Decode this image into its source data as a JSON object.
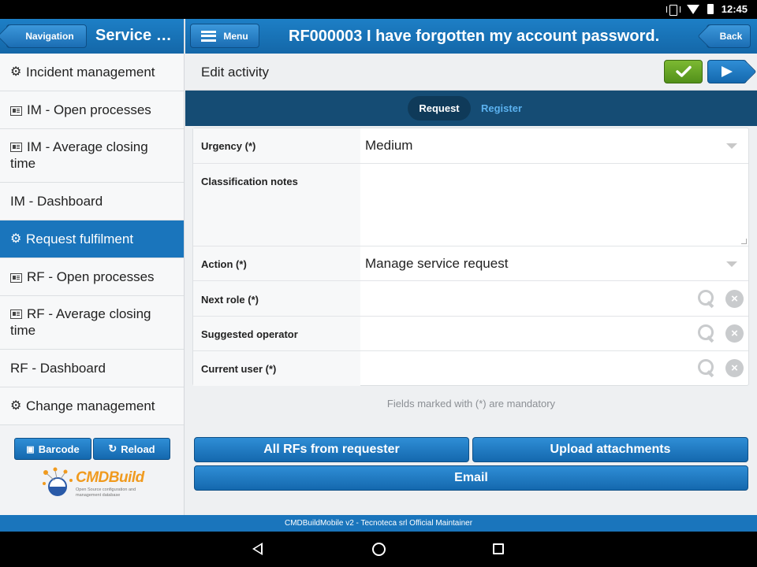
{
  "status_bar": {
    "time": "12:45",
    "icons": [
      "vibrate-icon",
      "wifi-icon",
      "battery-icon"
    ]
  },
  "sidebar": {
    "nav_button": "Navigation",
    "title": "Service d...",
    "items": [
      {
        "label": "Incident management",
        "icon": "gear-icon",
        "active": false
      },
      {
        "label": "IM - Open processes",
        "icon": "report-icon",
        "active": false
      },
      {
        "label": "IM - Average closing time",
        "icon": "report-icon",
        "active": false
      },
      {
        "label": "IM - Dashboard",
        "icon": "",
        "active": false
      },
      {
        "label": "Request fulfilment",
        "icon": "gear-icon",
        "active": true
      },
      {
        "label": "RF - Open processes",
        "icon": "report-icon",
        "active": false
      },
      {
        "label": "RF - Average closing time",
        "icon": "report-icon",
        "active": false
      },
      {
        "label": "RF - Dashboard",
        "icon": "",
        "active": false
      },
      {
        "label": "Change management",
        "icon": "gear-icon",
        "active": false
      }
    ],
    "barcode_button": "Barcode",
    "reload_button": "Reload",
    "logo": {
      "name": "CMDBuild",
      "tagline": "Open Source configuration and management database"
    }
  },
  "header": {
    "menu_button": "Menu",
    "title": "RF000003 I have forgotten my account password.",
    "back_button": "Back"
  },
  "edit_bar": {
    "title": "Edit activity"
  },
  "tabs": [
    {
      "label": "Request",
      "active": true
    },
    {
      "label": "Register",
      "active": false
    }
  ],
  "form": {
    "urgency": {
      "label": "Urgency (*)",
      "value": "Medium"
    },
    "classification_notes": {
      "label": "Classification notes",
      "value": ""
    },
    "action": {
      "label": "Action (*)",
      "value": "Manage service request"
    },
    "next_role": {
      "label": "Next role (*)",
      "value": ""
    },
    "suggested_operator": {
      "label": "Suggested operator",
      "value": ""
    },
    "current_user": {
      "label": "Current user (*)",
      "value": ""
    }
  },
  "mandatory_note": "Fields marked with (*) are mandatory",
  "actions": {
    "all_rfs": "All RFs from requester",
    "upload": "Upload attachments",
    "email": "Email"
  },
  "footer": "CMDBuildMobile v2 - Tecnoteca srl Official Maintainer",
  "colors": {
    "primary": "#1a75bc",
    "tab_strip": "#154c74",
    "confirm": "#6aa824",
    "brand": "#f09a1e"
  }
}
